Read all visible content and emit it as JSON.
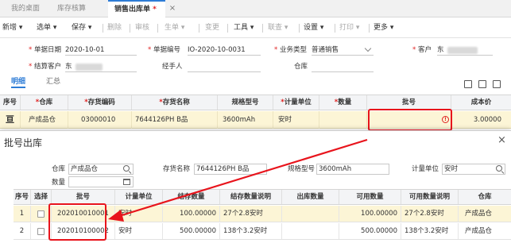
{
  "tabs": [
    {
      "label": "我的桌面"
    },
    {
      "label": "库存核算"
    },
    {
      "label": "销售出库单",
      "modified_mark": "*"
    }
  ],
  "tab_close": "×",
  "toolbar": {
    "new": "新增",
    "select_order": "选单",
    "save": "保存",
    "delete": "删除",
    "audit": "审核",
    "generate": "生单",
    "change": "变更",
    "tools": "工具",
    "query": "联查",
    "settings": "设置",
    "print": "打印",
    "more": "更多"
  },
  "form": {
    "doc_date_label": "单据日期",
    "doc_date_value": "2020-10-01",
    "doc_no_label": "单据编号",
    "doc_no_value": "IO-2020-10-0031",
    "biz_type_label": "业务类型",
    "biz_type_value": "普通销售",
    "customer_label": "客户",
    "customer_value": "东",
    "settle_customer_label": "结算客户",
    "settle_customer_value": "东",
    "handler_label": "经手人",
    "warehouse_label": "仓库"
  },
  "subtabs": {
    "detail": "明细",
    "summary": "汇总"
  },
  "main_table": {
    "headers": [
      "序号",
      "仓库",
      "存货编码",
      "存货名称",
      "规格型号",
      "计量单位",
      "数量",
      "批号",
      "成本价"
    ],
    "required_marks": [
      "",
      "*",
      "*",
      "*",
      "",
      "*",
      "*",
      "",
      ""
    ],
    "row": {
      "index_icon": "亘",
      "warehouse": "产成品仓",
      "code": "03000010",
      "name": "7644126PH B品",
      "spec": "3600mAh",
      "unit": "安时",
      "qty": "",
      "batch_warning_icon": "!",
      "cost": "3.00000"
    }
  },
  "dialog": {
    "title": "批号出库",
    "close": "×",
    "warehouse_label": "仓库",
    "warehouse_value": "产成品仓",
    "qty_label": "数量",
    "qty_value": "",
    "item_name_label": "存货名称",
    "item_name_value": "7644126PH B品",
    "spec_label": "规格型号",
    "spec_value": "3600mAh",
    "unit_label": "计量单位",
    "unit_value": "安时",
    "headers": [
      "序号",
      "选择",
      "批号",
      "计量单位",
      "结存数量",
      "结存数量说明",
      "出库数量",
      "可用数量",
      "可用数量说明",
      "仓库"
    ],
    "rows": [
      {
        "index": "1",
        "batch": "202010010001",
        "unit": "安时",
        "stock_qty": "100.00000",
        "stock_desc": "27个2.8安时",
        "out_qty": "",
        "avail_qty": "100.00000",
        "avail_desc": "27个2.8安时",
        "warehouse": "产成品仓"
      },
      {
        "index": "2",
        "batch": "202010100002",
        "unit": "安时",
        "stock_qty": "500.00000",
        "stock_desc": "138个3.2安时",
        "out_qty": "",
        "avail_qty": "500.00000",
        "avail_desc": "138个3.2安时",
        "warehouse": "产成品仓"
      }
    ]
  },
  "colors": {
    "accent": "#2d7cd6",
    "highlight_row": "#fcf5d6",
    "annotation_red": "#e8141c"
  }
}
